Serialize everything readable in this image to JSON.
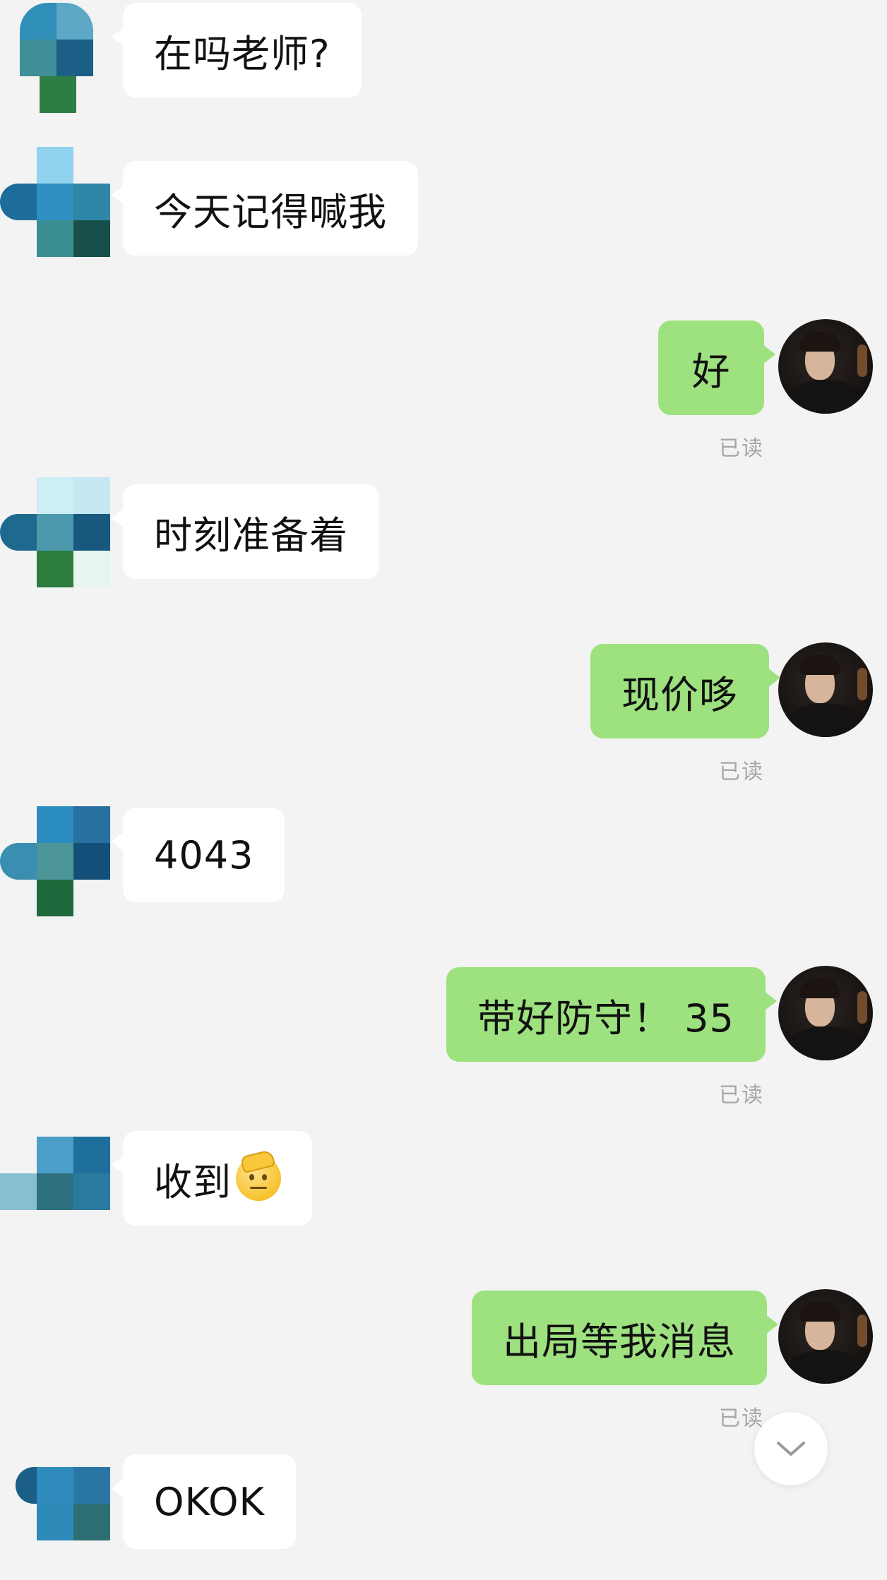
{
  "chat": {
    "read_label": "已读",
    "messages": [
      {
        "side": "in",
        "text": "在吗老师?"
      },
      {
        "side": "in",
        "text": "今天记得喊我"
      },
      {
        "side": "out",
        "text": "好"
      },
      {
        "side": "in",
        "text": "时刻准备着"
      },
      {
        "side": "out",
        "text": "现价哆"
      },
      {
        "side": "in",
        "text": "4043"
      },
      {
        "side": "out",
        "text": "带好防守！ 35"
      },
      {
        "side": "in",
        "text": "收到",
        "emoji": "salute-face-emoji"
      },
      {
        "side": "out",
        "text": "出局等我消息"
      },
      {
        "side": "in",
        "text": "OKOK"
      }
    ]
  },
  "colors": {
    "background": "#f3f3f3",
    "incoming_bubble": "#ffffff",
    "outgoing_bubble": "#9ee17f",
    "read_text": "#a6a6a6"
  },
  "icons": {
    "scroll_down": "chevron-down-icon",
    "incoming_avatar": "pixelated-avatar-icon",
    "outgoing_avatar": "user-photo-avatar"
  }
}
